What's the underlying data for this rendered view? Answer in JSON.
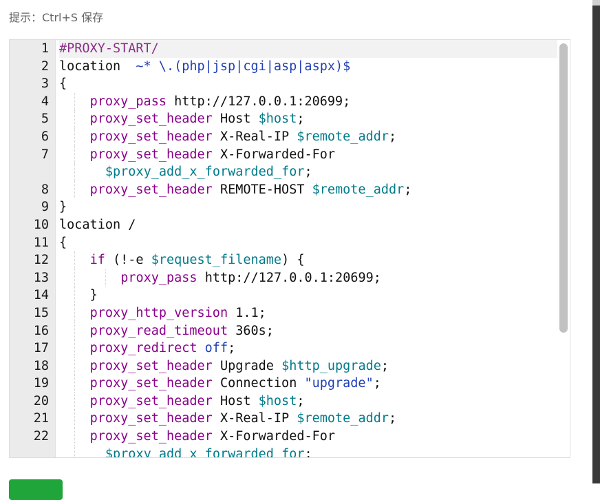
{
  "hint": "提示：Ctrl+S 保存",
  "editor": {
    "lines": [
      {
        "n": "1",
        "active": true,
        "indent": 0,
        "segs": [
          {
            "c": "c",
            "t": "#PROXY-START/"
          }
        ]
      },
      {
        "n": "2",
        "indent": 0,
        "segs": [
          {
            "c": "",
            "t": "location  "
          },
          {
            "c": "s",
            "t": "~* \\.(php|jsp|cgi|asp|aspx)$"
          }
        ]
      },
      {
        "n": "3",
        "indent": 0,
        "segs": [
          {
            "c": "",
            "t": "{"
          }
        ]
      },
      {
        "n": "4",
        "indent": 1,
        "segs": [
          {
            "c": "k",
            "t": "proxy_pass"
          },
          {
            "c": "",
            "t": " http://127.0.0.1:20699;"
          }
        ]
      },
      {
        "n": "5",
        "indent": 1,
        "segs": [
          {
            "c": "k",
            "t": "proxy_set_header"
          },
          {
            "c": "",
            "t": " Host "
          },
          {
            "c": "v",
            "t": "$host"
          },
          {
            "c": "",
            "t": ";"
          }
        ]
      },
      {
        "n": "6",
        "indent": 1,
        "segs": [
          {
            "c": "k",
            "t": "proxy_set_header"
          },
          {
            "c": "",
            "t": " X-Real-IP "
          },
          {
            "c": "v",
            "t": "$remote_addr"
          },
          {
            "c": "",
            "t": ";"
          }
        ]
      },
      {
        "n": "7",
        "indent": 1,
        "segs": [
          {
            "c": "k",
            "t": "proxy_set_header"
          },
          {
            "c": "",
            "t": " X-Forwarded-For"
          }
        ]
      },
      {
        "n": "",
        "indent": 1,
        "wrap": true,
        "segs": [
          {
            "c": "v",
            "t": "$proxy_add_x_forwarded_for"
          },
          {
            "c": "",
            "t": ";"
          }
        ]
      },
      {
        "n": "8",
        "indent": 1,
        "segs": [
          {
            "c": "k",
            "t": "proxy_set_header"
          },
          {
            "c": "",
            "t": " REMOTE-HOST "
          },
          {
            "c": "v",
            "t": "$remote_addr"
          },
          {
            "c": "",
            "t": ";"
          }
        ]
      },
      {
        "n": "9",
        "indent": 0,
        "segs": [
          {
            "c": "",
            "t": "}"
          }
        ]
      },
      {
        "n": "10",
        "indent": 0,
        "segs": [
          {
            "c": "",
            "t": "location /"
          }
        ]
      },
      {
        "n": "11",
        "indent": 0,
        "segs": [
          {
            "c": "",
            "t": "{"
          }
        ]
      },
      {
        "n": "12",
        "indent": 1,
        "segs": [
          {
            "c": "k",
            "t": "if"
          },
          {
            "c": "",
            "t": " (!-e "
          },
          {
            "c": "v",
            "t": "$request_filename"
          },
          {
            "c": "",
            "t": ") {"
          }
        ]
      },
      {
        "n": "13",
        "indent": 2,
        "segs": [
          {
            "c": "k",
            "t": "proxy_pass"
          },
          {
            "c": "",
            "t": " http://127.0.0.1:20699;"
          }
        ]
      },
      {
        "n": "14",
        "indent": 1,
        "segs": [
          {
            "c": "",
            "t": "}"
          }
        ]
      },
      {
        "n": "15",
        "indent": 1,
        "segs": [
          {
            "c": "k",
            "t": "proxy_http_version"
          },
          {
            "c": "",
            "t": " 1.1;"
          }
        ]
      },
      {
        "n": "16",
        "indent": 1,
        "segs": [
          {
            "c": "k",
            "t": "proxy_read_timeout"
          },
          {
            "c": "",
            "t": " 360s;"
          }
        ]
      },
      {
        "n": "17",
        "indent": 1,
        "segs": [
          {
            "c": "k",
            "t": "proxy_redirect"
          },
          {
            "c": "",
            "t": " "
          },
          {
            "c": "s",
            "t": "off"
          },
          {
            "c": "",
            "t": ";"
          }
        ]
      },
      {
        "n": "18",
        "indent": 1,
        "segs": [
          {
            "c": "k",
            "t": "proxy_set_header"
          },
          {
            "c": "",
            "t": " Upgrade "
          },
          {
            "c": "v",
            "t": "$http_upgrade"
          },
          {
            "c": "",
            "t": ";"
          }
        ]
      },
      {
        "n": "19",
        "indent": 1,
        "segs": [
          {
            "c": "k",
            "t": "proxy_set_header"
          },
          {
            "c": "",
            "t": " Connection "
          },
          {
            "c": "s",
            "t": "\"upgrade\""
          },
          {
            "c": "",
            "t": ";"
          }
        ]
      },
      {
        "n": "20",
        "indent": 1,
        "segs": [
          {
            "c": "k",
            "t": "proxy_set_header"
          },
          {
            "c": "",
            "t": " Host "
          },
          {
            "c": "v",
            "t": "$host"
          },
          {
            "c": "",
            "t": ";"
          }
        ]
      },
      {
        "n": "21",
        "indent": 1,
        "segs": [
          {
            "c": "k",
            "t": "proxy_set_header"
          },
          {
            "c": "",
            "t": " X-Real-IP "
          },
          {
            "c": "v",
            "t": "$remote_addr"
          },
          {
            "c": "",
            "t": ";"
          }
        ]
      },
      {
        "n": "22",
        "indent": 1,
        "segs": [
          {
            "c": "k",
            "t": "proxy_set_header"
          },
          {
            "c": "",
            "t": " X-Forwarded-For"
          }
        ]
      },
      {
        "n": "",
        "indent": 1,
        "wrap": true,
        "segs": [
          {
            "c": "v",
            "t": "$proxy_add_x_forwarded_for"
          },
          {
            "c": "",
            "t": ";"
          }
        ]
      }
    ]
  },
  "colors": {
    "keyword": "#8b008b",
    "variable": "#007b8a",
    "string": "#1f3fb5",
    "save_button": "#20a53a"
  }
}
